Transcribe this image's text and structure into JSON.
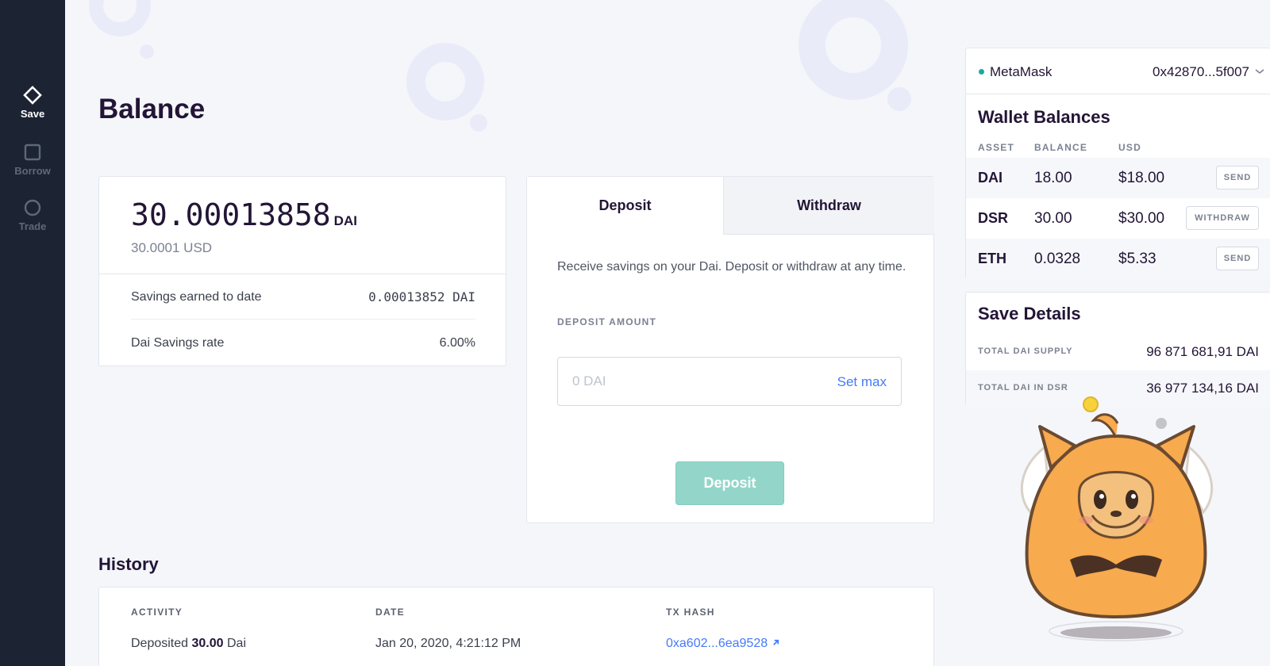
{
  "sidebar": {
    "items": [
      {
        "label": "Save",
        "icon": "diamond-icon",
        "active": true
      },
      {
        "label": "Borrow",
        "icon": "square-icon",
        "active": false
      },
      {
        "label": "Trade",
        "icon": "circle-icon",
        "active": false
      }
    ]
  },
  "page": {
    "title": "Balance"
  },
  "balance": {
    "amount": "30.00013858",
    "unit": "DAI",
    "usd": "30.0001 USD",
    "savings_label": "Savings earned to date",
    "savings_value": "0.00013852 DAI",
    "rate_label": "Dai Savings rate",
    "rate_value": "6.00%"
  },
  "deposit": {
    "tabs": [
      "Deposit",
      "Withdraw"
    ],
    "active_tab": "Deposit",
    "description": "Receive savings on your Dai. Deposit or withdraw at any time.",
    "amount_label": "DEPOSIT AMOUNT",
    "amount_value": "",
    "amount_placeholder": "0 DAI",
    "set_max": "Set max",
    "button": "Deposit"
  },
  "history": {
    "title": "History",
    "columns": [
      "ACTIVITY",
      "DATE",
      "TX HASH"
    ],
    "rows": [
      {
        "activity_prefix": "Deposited",
        "activity_amount": "30.00",
        "activity_suffix": "Dai",
        "date": "Jan 20, 2020, 4:21:12 PM",
        "tx_hash": "0xa602...6ea9528"
      }
    ]
  },
  "wallet": {
    "name": "MetaMask",
    "address": "0x42870...5f007",
    "status_color": "#1aab9b"
  },
  "wallet_balances": {
    "title": "Wallet Balances",
    "columns": [
      "ASSET",
      "BALANCE",
      "USD"
    ],
    "rows": [
      {
        "asset": "DAI",
        "balance": "18.00",
        "usd": "$18.00",
        "action": "SEND"
      },
      {
        "asset": "DSR",
        "balance": "30.00",
        "usd": "$30.00",
        "action": "WITHDRAW"
      },
      {
        "asset": "ETH",
        "balance": "0.0328",
        "usd": "$5.33",
        "action": "SEND"
      }
    ]
  },
  "save_details": {
    "title": "Save Details",
    "rows": [
      {
        "label": "TOTAL DAI SUPPLY",
        "value": "96 871 681,91 DAI"
      },
      {
        "label": "TOTAL DAI IN DSR",
        "value": "36 977 134,16 DAI"
      }
    ]
  },
  "colors": {
    "sidebar": "#1c2433",
    "accent_link": "#447afb",
    "deposit_button": "#93d6c9",
    "background": "#f4f6fa"
  }
}
